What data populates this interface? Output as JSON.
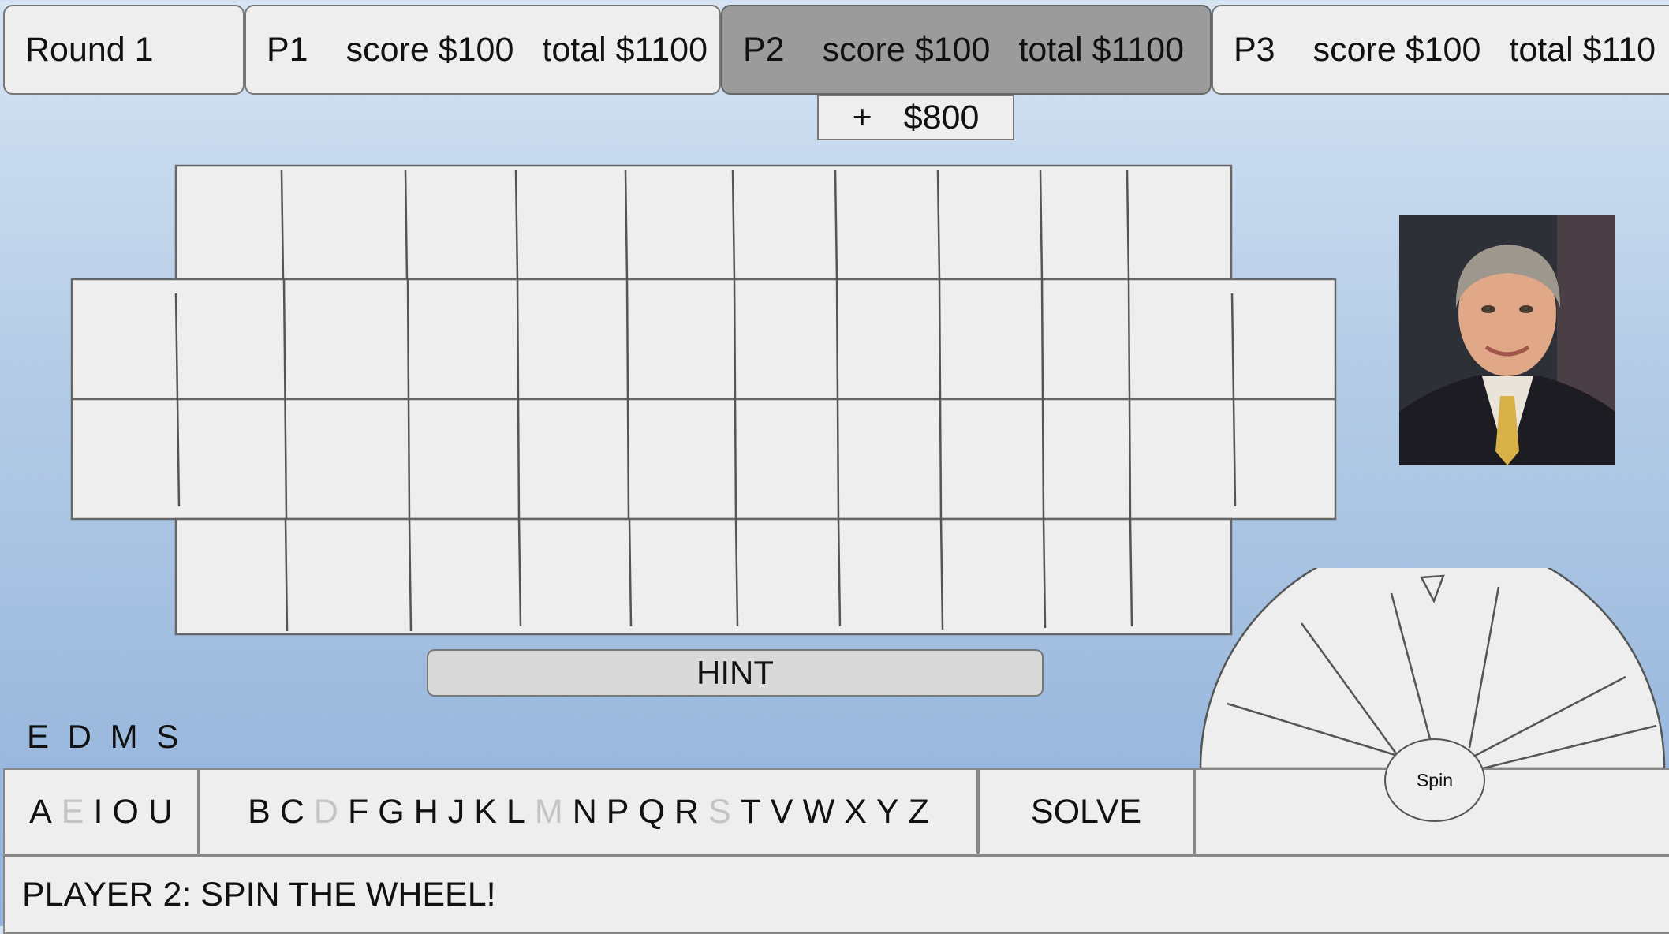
{
  "header": {
    "round": "Round 1",
    "players": [
      {
        "name": "P1",
        "score": "score $100",
        "total": "total $1100",
        "active": false
      },
      {
        "name": "P2",
        "score": "score $100",
        "total": "total $1100",
        "active": true
      },
      {
        "name": "P3",
        "score": "score $100",
        "total": "total $110",
        "active": false
      }
    ]
  },
  "pending": {
    "plus": "+",
    "amount": "$800"
  },
  "hint_label": "HINT",
  "used_letters": "E D M S",
  "vowels": [
    {
      "ch": "A",
      "used": false
    },
    {
      "ch": "E",
      "used": true
    },
    {
      "ch": "I",
      "used": false
    },
    {
      "ch": "O",
      "used": false
    },
    {
      "ch": "U",
      "used": false
    }
  ],
  "consonants": [
    {
      "ch": "B",
      "used": false
    },
    {
      "ch": "C",
      "used": false
    },
    {
      "ch": "D",
      "used": true
    },
    {
      "ch": "F",
      "used": false
    },
    {
      "ch": "G",
      "used": false
    },
    {
      "ch": "H",
      "used": false
    },
    {
      "ch": "J",
      "used": false
    },
    {
      "ch": "K",
      "used": false
    },
    {
      "ch": "L",
      "used": false
    },
    {
      "ch": "M",
      "used": true
    },
    {
      "ch": "N",
      "used": false
    },
    {
      "ch": "P",
      "used": false
    },
    {
      "ch": "Q",
      "used": false
    },
    {
      "ch": "R",
      "used": false
    },
    {
      "ch": "S",
      "used": true
    },
    {
      "ch": "T",
      "used": false
    },
    {
      "ch": "V",
      "used": false
    },
    {
      "ch": "W",
      "used": false
    },
    {
      "ch": "X",
      "used": false
    },
    {
      "ch": "Y",
      "used": false
    },
    {
      "ch": "Z",
      "used": false
    }
  ],
  "solve_label": "SOLVE",
  "spin_label": "Spin",
  "status_message": "PLAYER 2: SPIN THE WHEEL!",
  "host_photo": "host-portrait-image",
  "colors": {
    "bg_top": "#d6e4f3",
    "bg_bottom": "#8fb0d9",
    "panel": "#eeeeee",
    "active_panel": "#9b9b9b",
    "used_letter": "#c4c4c4"
  }
}
